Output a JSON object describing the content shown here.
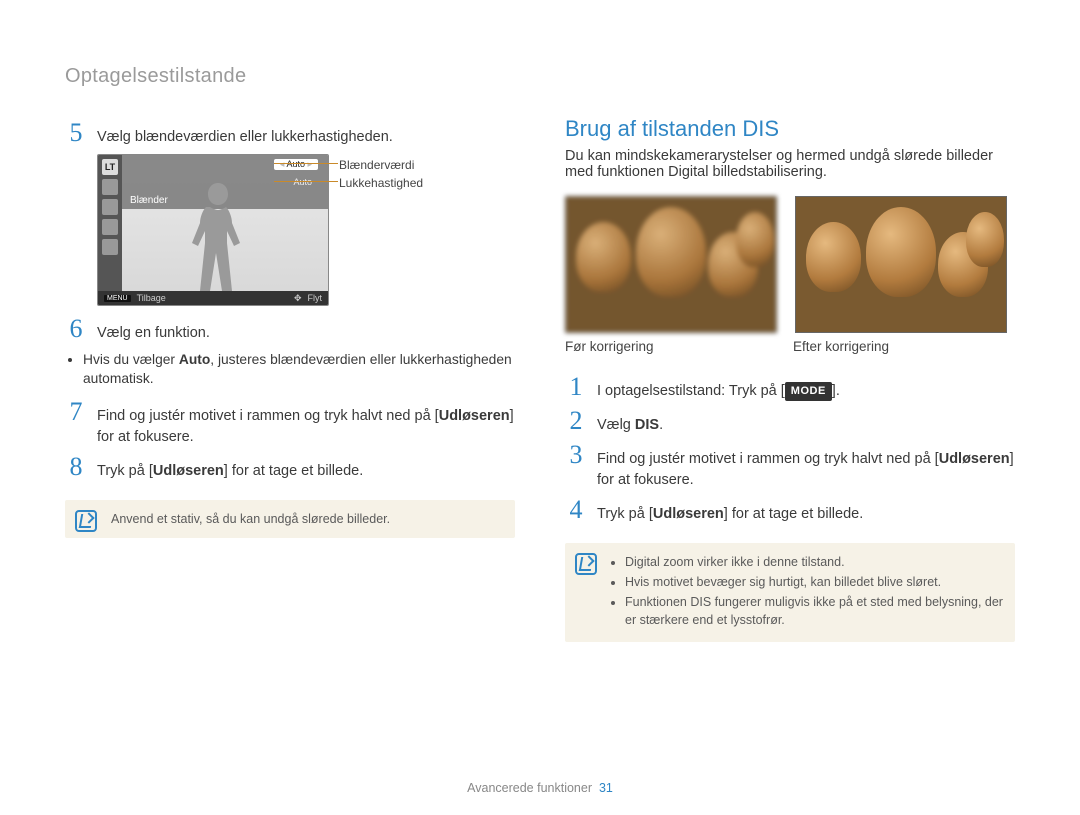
{
  "breadcrumb": "Optagelsestilstande",
  "left": {
    "step5": {
      "num": "5",
      "text": "Vælg blændeværdien eller lukkerhastigheden."
    },
    "cam": {
      "lt": "LT",
      "row1_label": "",
      "row1_value": "Auto",
      "row2_label": "",
      "row2_value": "Auto",
      "row3_label": "Blænder",
      "footer_menu": "MENU",
      "footer_back": "Tilbage",
      "footer_move_icon": "✥",
      "footer_move": "Flyt",
      "callout1": "Blænderværdi",
      "callout2": "Lukkehastighed"
    },
    "step6": {
      "num": "6",
      "text": "Vælg en funktion.",
      "bullet_pre": "Hvis du vælger ",
      "bullet_bold": "Auto",
      "bullet_post": ", justeres blændeværdien eller lukkerhastigheden automatisk."
    },
    "step7": {
      "num": "7",
      "text_pre": "Find og justér motivet i rammen og tryk halvt ned på [",
      "text_bold": "Udløseren",
      "text_post": "] for at fokusere."
    },
    "step8": {
      "num": "8",
      "text_pre": "Tryk på [",
      "text_bold": "Udløseren",
      "text_post": "] for at tage et billede."
    },
    "note": "Anvend et stativ, så du kan undgå slørede billeder."
  },
  "right": {
    "heading": "Brug af tilstanden DIS",
    "intro": "Du kan mindskekamerarystelser og hermed undgå slørede billeder med funktionen Digital billedstabilisering.",
    "caption_before": "Før korrigering",
    "caption_after": "Efter korrigering",
    "step1": {
      "num": "1",
      "text_pre": "I optagelsestilstand: Tryk på [",
      "badge": "MODE",
      "text_post": "]."
    },
    "step2": {
      "num": "2",
      "text_pre": "Vælg ",
      "text_bold": "DIS",
      "text_post": "."
    },
    "step3": {
      "num": "3",
      "text_pre": "Find og justér motivet i rammen og tryk halvt ned på [",
      "text_bold": "Udløseren",
      "text_post": "] for at fokusere."
    },
    "step4": {
      "num": "4",
      "text_pre": "Tryk på [",
      "text_bold": "Udløseren",
      "text_post": "] for at tage et billede."
    },
    "notes": [
      "Digital zoom virker ikke i denne tilstand.",
      "Hvis motivet bevæger sig hurtigt, kan billedet blive sløret.",
      "Funktionen DIS fungerer muligvis ikke på et sted med belysning, der er stærkere end et lysstofrør."
    ]
  },
  "footer": {
    "section": "Avancerede funktioner",
    "page": "31"
  }
}
